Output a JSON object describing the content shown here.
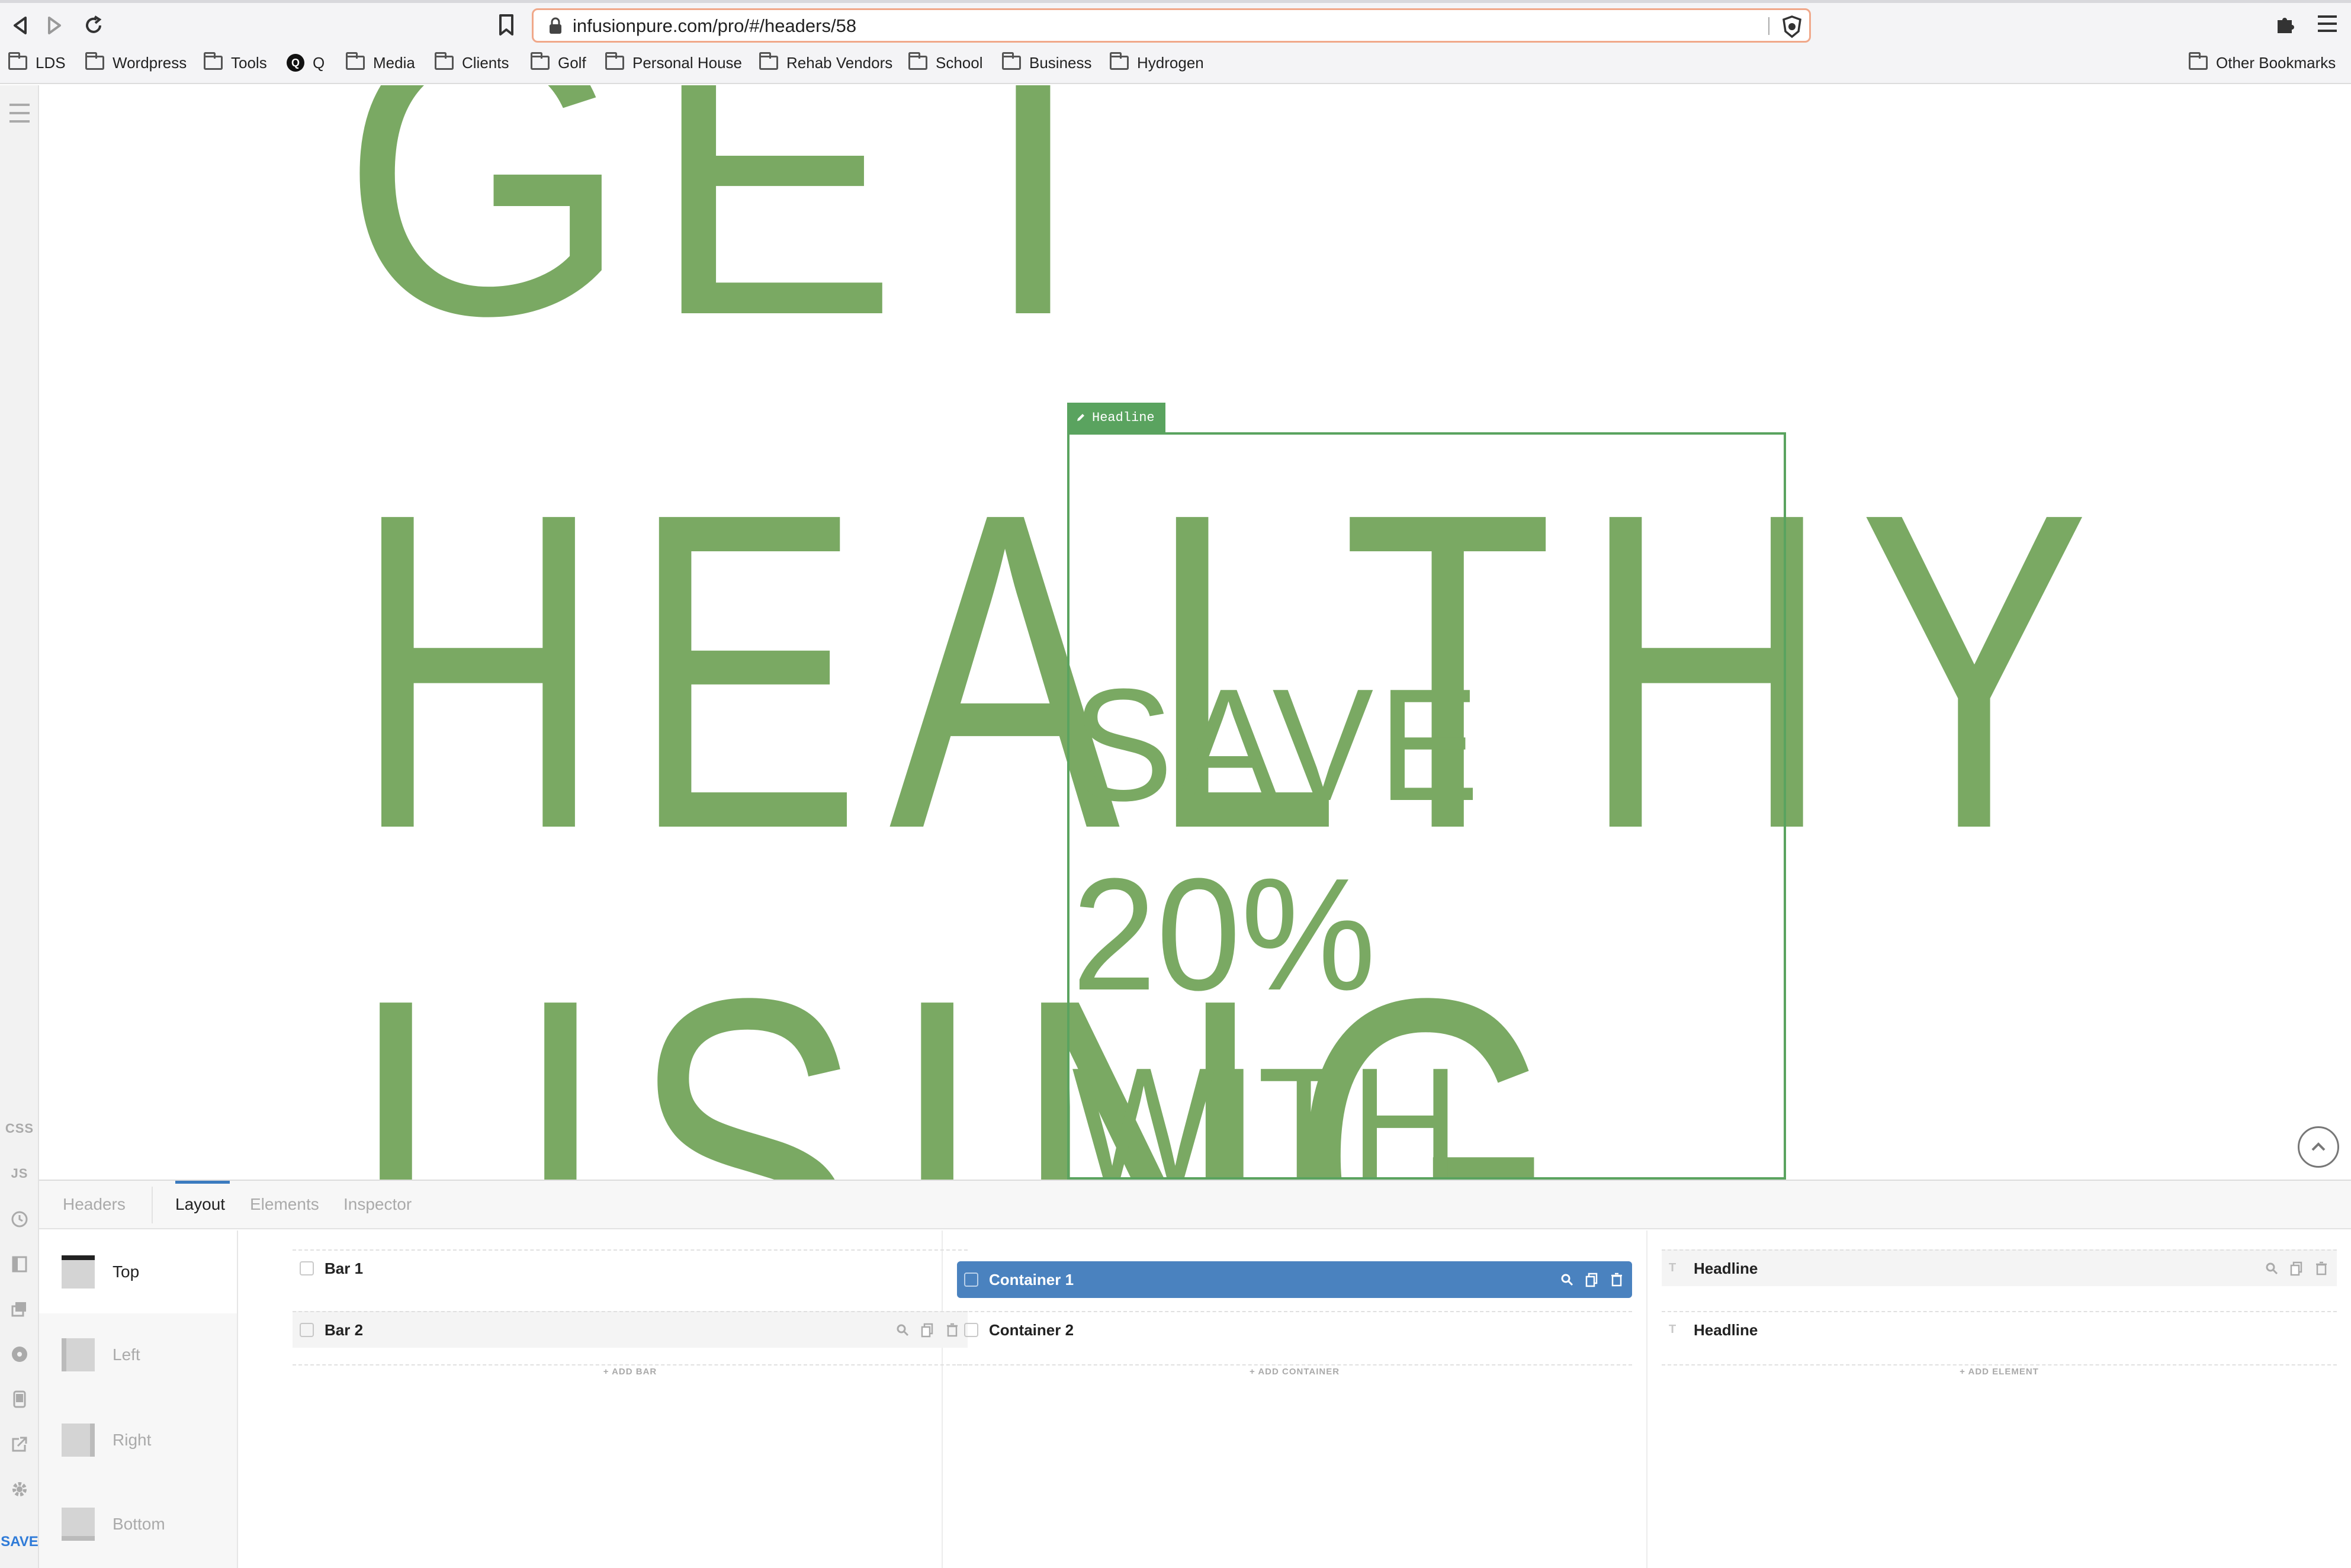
{
  "browser": {
    "url": "infusionpure.com/pro/#/headers/58",
    "bookmarks": [
      "LDS",
      "Wordpress",
      "Tools",
      "Q",
      "Media",
      "Clients",
      "Golf",
      "Personal House",
      "Rehab Vendors",
      "School",
      "Business",
      "Hydrogen"
    ],
    "other_bookmarks": "Other Bookmarks"
  },
  "sidebar": {
    "css_label": "CSS",
    "js_label": "JS",
    "save_label": "SAVE",
    "icons": [
      "menu-icon",
      "history-icon",
      "layout-icon",
      "layers-icon",
      "record-icon",
      "device-icon",
      "external-link-icon",
      "gear-icon"
    ]
  },
  "preview": {
    "big_lines": [
      "GET",
      "HEALTHY",
      "USING"
    ],
    "selected_tag": "Headline",
    "small_lines": [
      "SAVE",
      "20%",
      "WITH"
    ],
    "colors": {
      "text": "#7aa963",
      "selection": "#5aa35f"
    }
  },
  "panel": {
    "tabs": [
      "Headers",
      "Layout",
      "Elements",
      "Inspector"
    ],
    "active_tab": "Layout",
    "regions": [
      "Top",
      "Left",
      "Right",
      "Bottom"
    ],
    "active_region": "Top",
    "bars": [
      "Bar 1",
      "Bar 2"
    ],
    "add_bar": "+ ADD BAR",
    "containers": [
      "Container 1",
      "Container 2"
    ],
    "add_container": "+ ADD CONTAINER",
    "elements": [
      "Headline",
      "Headline"
    ],
    "add_element": "+ ADD ELEMENT",
    "colors": {
      "selected_row": "#4a82bf",
      "tab_underline": "#3b7bbf"
    }
  }
}
